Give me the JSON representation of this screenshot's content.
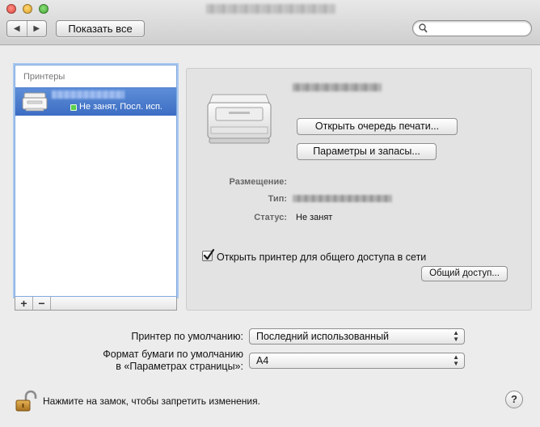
{
  "window": {
    "title": "",
    "colors": {
      "selection": "#3b6dc3",
      "status_available": "#5bd04c"
    }
  },
  "toolbar": {
    "back_icon": "chevron-left-icon",
    "forward_icon": "chevron-right-icon",
    "show_all_label": "Показать все",
    "search_placeholder": ""
  },
  "sidebar": {
    "header": "Принтеры",
    "printers": [
      {
        "name": "",
        "status": "Не занят, Посл. исп.",
        "selected": true,
        "icon": "printer-icon"
      }
    ],
    "add_label": "+",
    "remove_label": "−"
  },
  "detail": {
    "printer_name": "",
    "open_queue_label": "Открыть очередь печати...",
    "options_supplies_label": "Параметры и запасы...",
    "location_label": "Размещение:",
    "location_value": "",
    "type_label": "Тип:",
    "type_value": "",
    "status_label": "Статус:",
    "status_value": "Не занят",
    "share_checked": true,
    "share_label": "Открыть принтер для общего доступа в сети",
    "sharing_prefs_label": "Общий доступ..."
  },
  "defaults": {
    "default_printer_label": "Принтер по умолчанию:",
    "default_printer_value": "Последний использованный",
    "paper_label_line1": "Формат бумаги по умолчанию",
    "paper_label_line2": "в «Параметрах страницы»:",
    "paper_value": "A4"
  },
  "footer": {
    "lock_text": "Нажмите на замок, чтобы запретить изменения.",
    "lock_icon": "lock-open-icon",
    "help_label": "?"
  }
}
